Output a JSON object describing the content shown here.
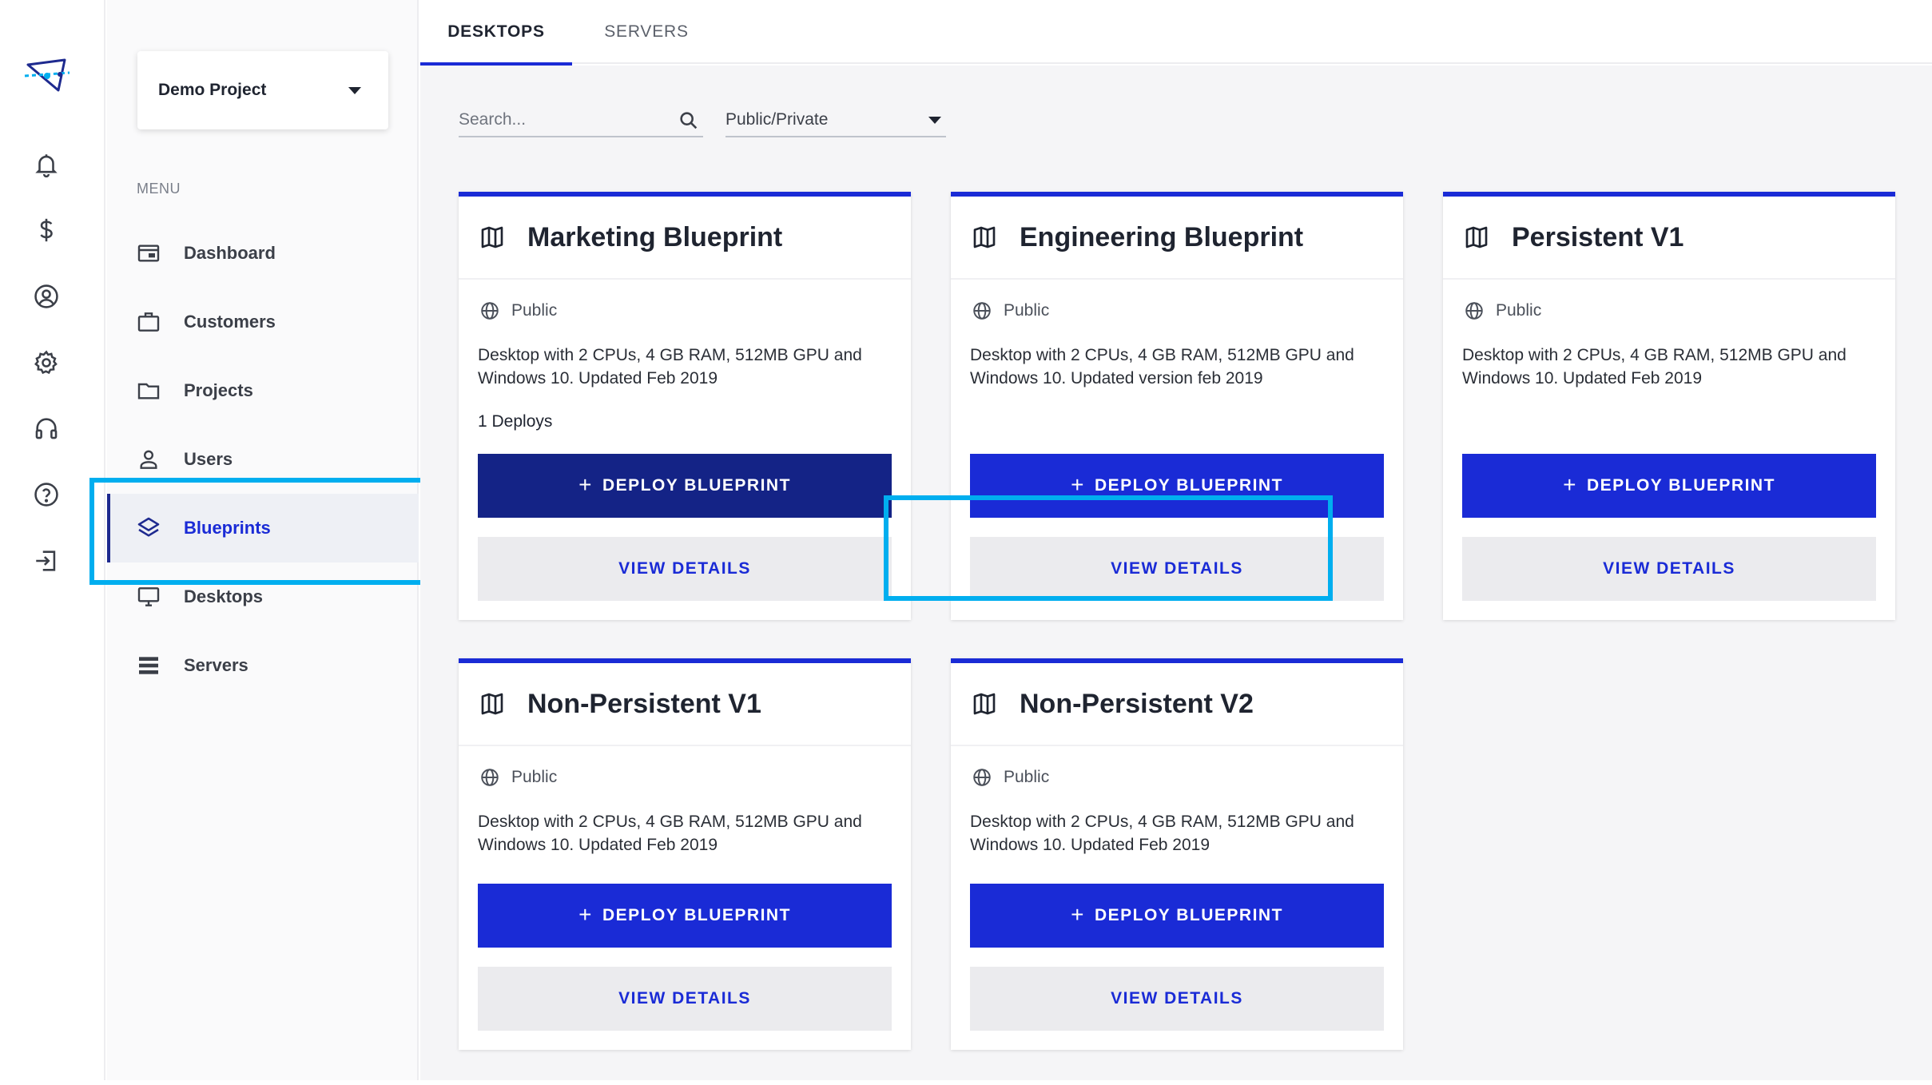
{
  "colors": {
    "accent": "#1a2bd6",
    "accent_dark": "#142386",
    "highlight": "#00aeef"
  },
  "rail": {
    "logo": "app-logo-icon",
    "icons": [
      "bell-icon",
      "dollar-icon",
      "user-circle-icon",
      "gear-icon",
      "headset-icon",
      "help-circle-icon",
      "logout-icon"
    ]
  },
  "project_selector": {
    "value": "Demo Project"
  },
  "menu": {
    "caption": "MENU",
    "items": [
      {
        "label": "Dashboard",
        "icon": "dashboard-icon"
      },
      {
        "label": "Customers",
        "icon": "briefcase-icon"
      },
      {
        "label": "Projects",
        "icon": "folder-icon"
      },
      {
        "label": "Users",
        "icon": "user-icon"
      },
      {
        "label": "Blueprints",
        "icon": "layers-icon",
        "active": true
      },
      {
        "label": "Desktops",
        "icon": "monitor-icon"
      },
      {
        "label": "Servers",
        "icon": "server-list-icon"
      }
    ]
  },
  "tabs": [
    {
      "label": "DESKTOPS",
      "active": true
    },
    {
      "label": "SERVERS",
      "active": false
    }
  ],
  "filters": {
    "search_placeholder": "Search...",
    "visibility_value": "Public/Private"
  },
  "cards": [
    {
      "title": "Marketing Blueprint",
      "visibility": "Public",
      "description": "Desktop with 2 CPUs, 4 GB RAM, 512MB GPU and Windows 10. Updated Feb 2019",
      "deploys": "1 Deploys",
      "deploy_label": "DEPLOY BLUEPRINT",
      "details_label": "VIEW DETAILS"
    },
    {
      "title": "Engineering Blueprint",
      "visibility": "Public",
      "description": "Desktop with 2 CPUs, 4 GB RAM, 512MB GPU and Windows 10. Updated version feb 2019",
      "deploy_label": "DEPLOY BLUEPRINT",
      "details_label": "VIEW DETAILS"
    },
    {
      "title": "Persistent V1",
      "visibility": "Public",
      "description": "Desktop with 2 CPUs, 4 GB RAM, 512MB GPU and Windows 10. Updated Feb 2019",
      "deploy_label": "DEPLOY BLUEPRINT",
      "details_label": "VIEW DETAILS"
    },
    {
      "title": "Non-Persistent V1",
      "visibility": "Public",
      "description": "Desktop with 2 CPUs, 4 GB RAM, 512MB GPU and Windows 10. Updated Feb 2019",
      "deploy_label": "DEPLOY BLUEPRINT",
      "details_label": "VIEW DETAILS"
    },
    {
      "title": "Non-Persistent V2",
      "visibility": "Public",
      "description": "Desktop with 2 CPUs, 4 GB RAM, 512MB GPU and Windows 10. Updated Feb 2019",
      "deploy_label": "DEPLOY BLUEPRINT",
      "details_label": "VIEW DETAILS"
    }
  ]
}
